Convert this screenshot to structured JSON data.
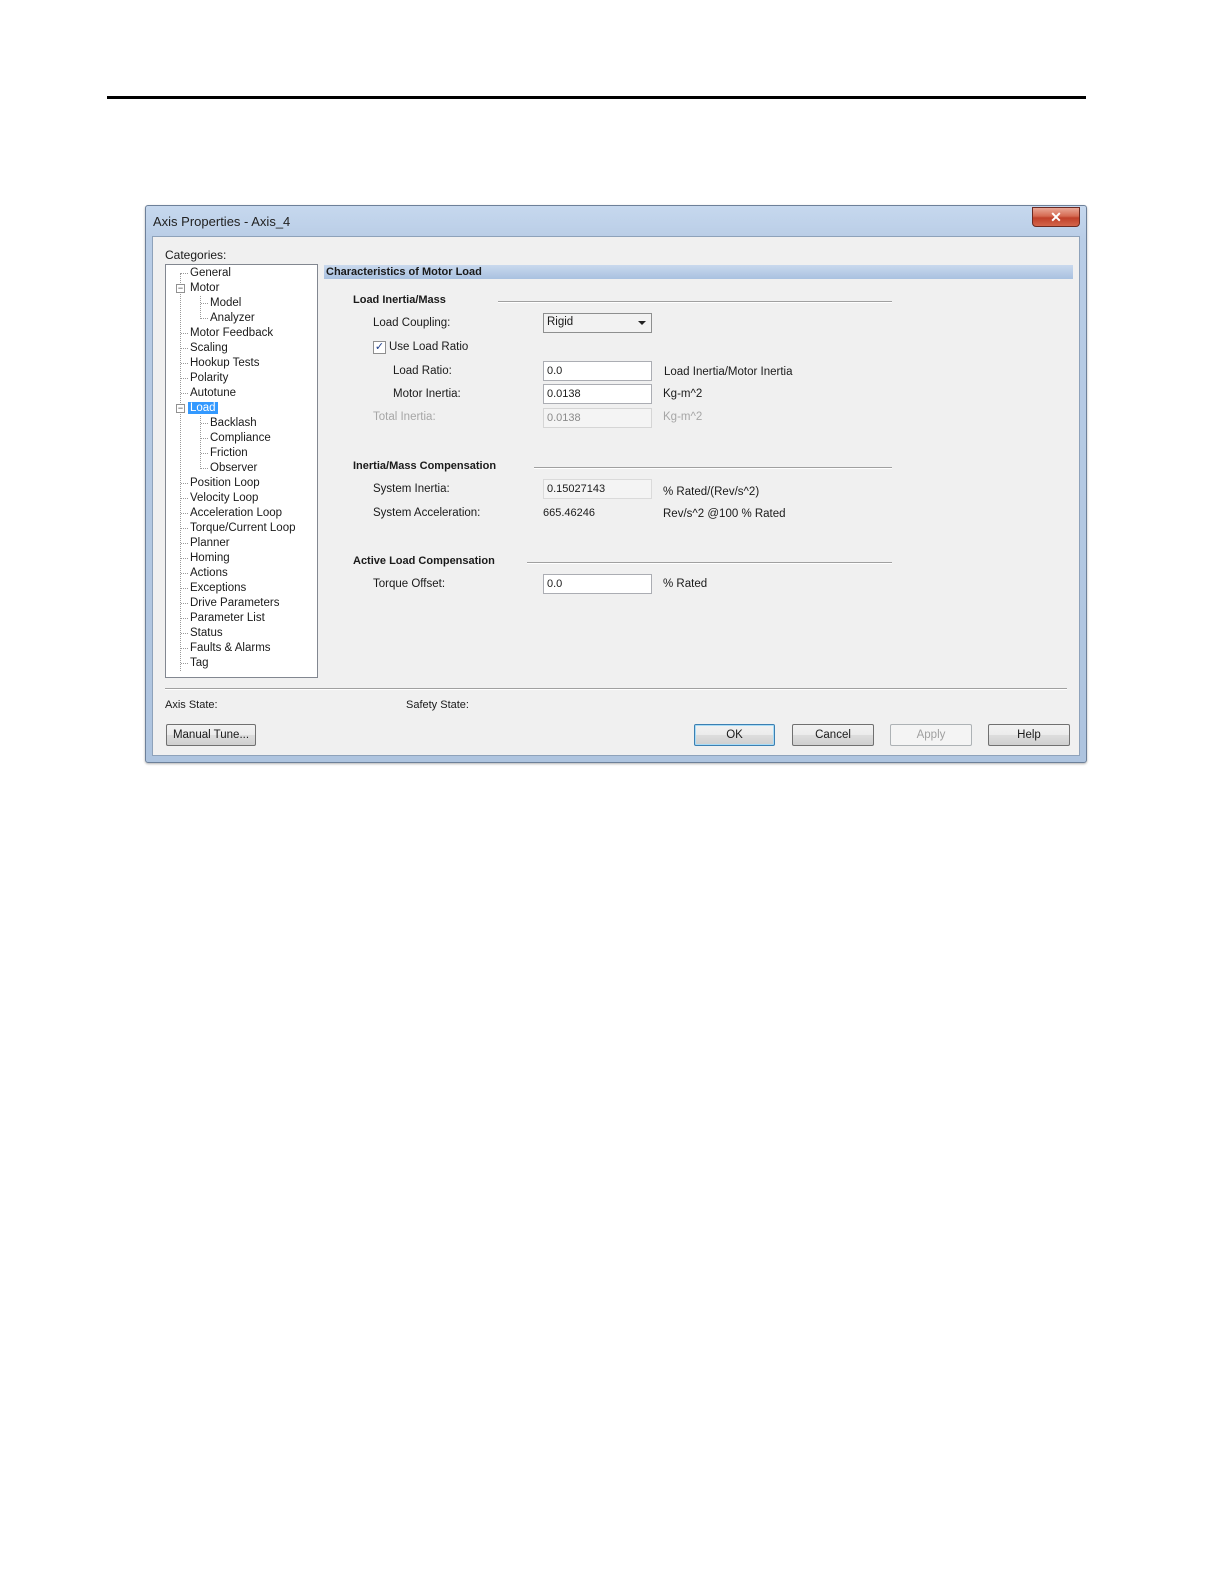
{
  "window": {
    "title": "Axis Properties - Axis_4",
    "close_glyph": "✕"
  },
  "categories": {
    "label": "Categories:",
    "items": [
      {
        "label": "General"
      },
      {
        "label": "Motor"
      },
      {
        "label": "Model"
      },
      {
        "label": "Analyzer"
      },
      {
        "label": "Motor Feedback"
      },
      {
        "label": "Scaling"
      },
      {
        "label": "Hookup Tests"
      },
      {
        "label": "Polarity"
      },
      {
        "label": "Autotune"
      },
      {
        "label": "Load"
      },
      {
        "label": "Backlash"
      },
      {
        "label": "Compliance"
      },
      {
        "label": "Friction"
      },
      {
        "label": "Observer"
      },
      {
        "label": "Position Loop"
      },
      {
        "label": "Velocity Loop"
      },
      {
        "label": "Acceleration Loop"
      },
      {
        "label": "Torque/Current Loop"
      },
      {
        "label": "Planner"
      },
      {
        "label": "Homing"
      },
      {
        "label": "Actions"
      },
      {
        "label": "Exceptions"
      },
      {
        "label": "Drive Parameters"
      },
      {
        "label": "Parameter List"
      },
      {
        "label": "Status"
      },
      {
        "label": "Faults & Alarms"
      },
      {
        "label": "Tag"
      }
    ],
    "selected": "Load"
  },
  "panel": {
    "header": "Characteristics of Motor Load",
    "load_inertia": {
      "title": "Load Inertia/Mass",
      "load_coupling_label": "Load Coupling:",
      "load_coupling_value": "Rigid",
      "use_load_ratio_label": "Use Load Ratio",
      "use_load_ratio_checked": true,
      "check_glyph": "✓",
      "load_ratio_label": "Load Ratio:",
      "load_ratio_value": "0.0",
      "load_ratio_units": "Load Inertia/Motor Inertia",
      "motor_inertia_label": "Motor Inertia:",
      "motor_inertia_value": "0.0138",
      "motor_inertia_units": "Kg-m^2",
      "total_inertia_label": "Total Inertia:",
      "total_inertia_value": "0.0138",
      "total_inertia_units": "Kg-m^2"
    },
    "compensation": {
      "title": "Inertia/Mass Compensation",
      "system_inertia_label": "System Inertia:",
      "system_inertia_value": "0.15027143",
      "system_inertia_units": "% Rated/(Rev/s^2)",
      "system_accel_label": "System Acceleration:",
      "system_accel_value": "665.46246",
      "system_accel_units": "Rev/s^2 @100 % Rated"
    },
    "active_load": {
      "title": "Active Load Compensation",
      "torque_offset_label": "Torque Offset:",
      "torque_offset_value": "0.0",
      "torque_offset_units": "% Rated"
    }
  },
  "footer": {
    "axis_state_label": "Axis State:",
    "safety_state_label": "Safety State:",
    "manual_tune_label": "Manual Tune...",
    "ok_label": "OK",
    "cancel_label": "Cancel",
    "apply_label": "Apply",
    "help_label": "Help"
  }
}
